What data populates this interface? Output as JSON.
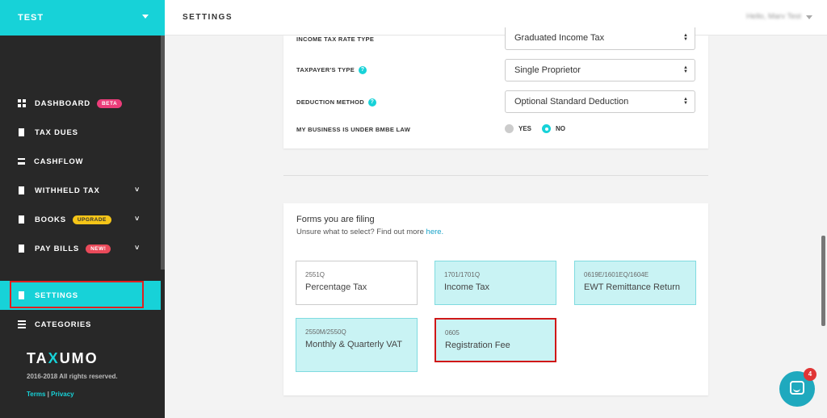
{
  "sidebar": {
    "org_name": "TEST",
    "items": [
      {
        "label": "DASHBOARD",
        "badge": "BETA"
      },
      {
        "label": "TAX DUES"
      },
      {
        "label": "CASHFLOW"
      },
      {
        "label": "WITHHELD TAX"
      },
      {
        "label": "BOOKS",
        "badge": "UPGRADE"
      },
      {
        "label": "PAY BILLS",
        "badge": "NEW!"
      },
      {
        "label": "SETTINGS"
      },
      {
        "label": "CATEGORIES"
      }
    ],
    "brand_part1": "TA",
    "brand_part2": "X",
    "brand_part3": "UMO",
    "copyright": "2016-2018 All rights reserved.",
    "terms_label": "Terms",
    "separator": "|",
    "privacy_label": "Privacy"
  },
  "header": {
    "title": "SETTINGS",
    "user_greeting": "Hello, Marv Test"
  },
  "tax_settings": {
    "rows": [
      {
        "label": "INCOME TAX RATE TYPE",
        "value": "Graduated Income Tax"
      },
      {
        "label": "TAXPAYER'S TYPE",
        "value": "Single Proprietor"
      },
      {
        "label": "DEDUCTION METHOD",
        "value": "Optional Standard Deduction"
      }
    ],
    "bmbe_label": "MY BUSINESS IS UNDER BMBE LAW",
    "bmbe_yes": "YES",
    "bmbe_no": "NO",
    "bmbe_selected": "NO"
  },
  "forms": {
    "title": "Forms you are filing",
    "subtitle": "Unsure what to select? Find out more ",
    "link_label": "here.",
    "tiles": [
      {
        "code": "2551Q",
        "name": "Percentage Tax",
        "selected": false
      },
      {
        "code": "1701/1701Q",
        "name": "Income Tax",
        "selected": true
      },
      {
        "code": "0619E/1601EQ/1604E",
        "name": "EWT Remittance Return",
        "selected": true
      },
      {
        "code": "2550M/2550Q",
        "name": "Monthly & Quarterly VAT",
        "selected": true
      },
      {
        "code": "0605",
        "name": "Registration Fee",
        "selected": true
      }
    ]
  },
  "chat": {
    "unread_count": "4"
  },
  "icons": {
    "help": "?",
    "chevron": "˅",
    "select_arrows_up": "▲",
    "select_arrows_down": "▼"
  },
  "colors": {
    "accent": "#17d2d8",
    "sidebar_bg": "#282828",
    "highlight_outline": "#e02020"
  }
}
